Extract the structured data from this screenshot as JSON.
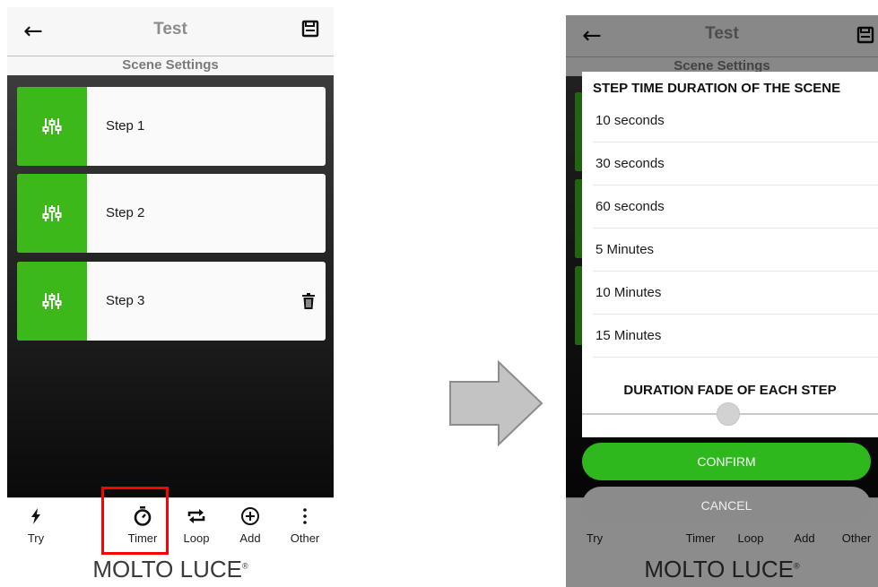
{
  "header": {
    "title": "Test",
    "subtitle": "Scene Settings",
    "back_icon": "arrow-left",
    "save_icon": "floppy-disk"
  },
  "steps": [
    {
      "label": "Step 1"
    },
    {
      "label": "Step 2"
    },
    {
      "label": "Step 3"
    }
  ],
  "bottom_nav": {
    "try": "Try",
    "timer": "Timer",
    "loop": "Loop",
    "add": "Add",
    "other": "Other"
  },
  "brand": {
    "logo_text": "MOLTO LUCE",
    "registered": "®"
  },
  "modal": {
    "title": "STEP TIME DURATION OF THE SCENE",
    "options": [
      "10 seconds",
      "30 seconds",
      "60 seconds",
      "5 Minutes",
      "10 Minutes",
      "15 Minutes"
    ],
    "fade_title": "DURATION FADE OF EACH STEP",
    "fade_slider_value": 0.5,
    "confirm_label": "CONFIRM",
    "cancel_label": "CANCEL"
  },
  "colors": {
    "accent_green": "#3db81a",
    "confirm_green": "#2eb81d",
    "highlight_red": "#ff0000"
  }
}
